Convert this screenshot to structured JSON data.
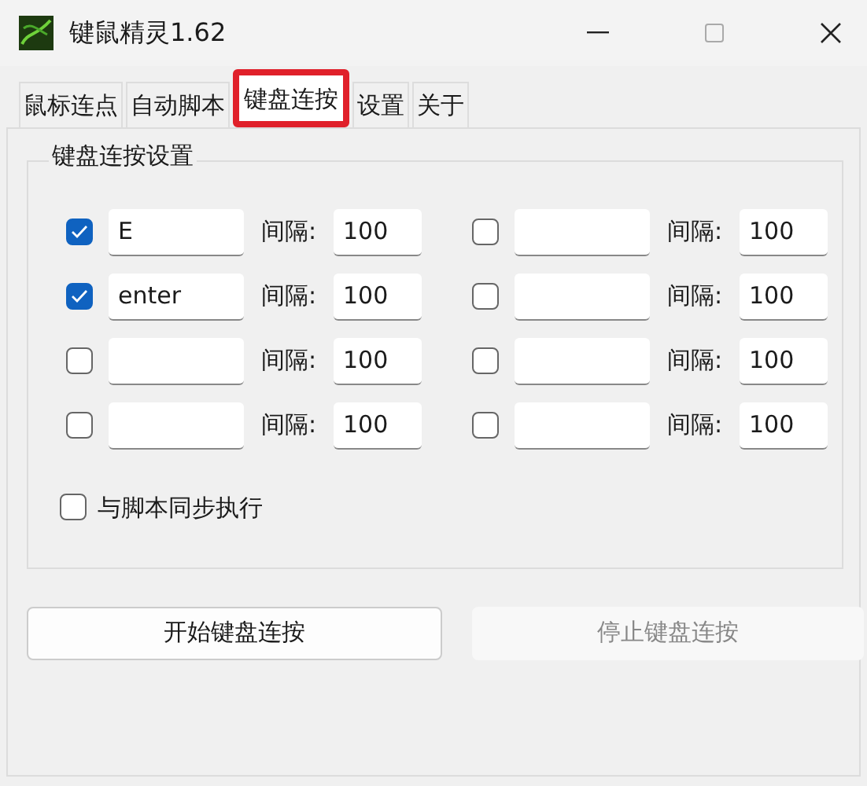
{
  "window": {
    "title": "键鼠精灵1.62",
    "maximize_disabled": true
  },
  "tabs": [
    {
      "label": "鼠标连点",
      "selected": false
    },
    {
      "label": "自动脚本",
      "selected": false
    },
    {
      "label": "键盘连按",
      "selected": true
    },
    {
      "label": "设置",
      "selected": false
    },
    {
      "label": "关于",
      "selected": false
    }
  ],
  "group": {
    "title": "键盘连按设置",
    "slots": [
      {
        "checked": true,
        "key": "E",
        "interval_label": "间隔:",
        "interval": "100"
      },
      {
        "checked": false,
        "interval_label": "间隔:",
        "interval": "100"
      },
      {
        "checked": true,
        "key": "enter",
        "interval_label": "间隔:",
        "interval": "100"
      },
      {
        "checked": false,
        "interval_label": "间隔:",
        "interval": "100"
      },
      {
        "checked": false,
        "interval_label": "间隔:",
        "interval": "100"
      },
      {
        "checked": false,
        "interval_label": "间隔:",
        "interval": "100"
      },
      {
        "checked": false,
        "interval_label": "间隔:",
        "interval": "100"
      },
      {
        "checked": false,
        "interval_label": "间隔:",
        "interval": "100"
      }
    ],
    "sync": {
      "label": "与脚本同步执行",
      "checked": false
    }
  },
  "buttons": [
    {
      "label": "开始键盘连按",
      "disabled": false
    },
    {
      "label": "停止键盘连按",
      "disabled": true
    }
  ]
}
